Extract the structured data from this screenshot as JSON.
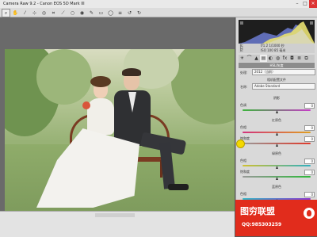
{
  "window": {
    "title": "Camera Raw 9.2 - Canon EOS 5D Mark III"
  },
  "window_buttons": {
    "minimize": "–",
    "maximize": "□",
    "close": "×"
  },
  "histogram": {
    "r_label": "R:",
    "g_label": "G:",
    "b_label": "B:",
    "line1": "f/1.2  1/1000 秒",
    "line2": "ISO 100  85 毫米"
  },
  "panel": {
    "title": "HSL/灰度",
    "process_label": "处理:",
    "process_value": "2012（当前）",
    "profile_header": "相机配置文件",
    "profile_label": "名称:",
    "profile_value": "Adobe Standard",
    "sections": {
      "shadows": "阴影",
      "reds": "红原色",
      "greens": "绿原色",
      "blues": "蓝原色"
    },
    "labels": {
      "tint": "色调",
      "hue": "色相",
      "saturation": "饱和度"
    },
    "values": {
      "shadow_tint": "0",
      "red_hue": "0",
      "red_saturation": "0",
      "green_hue": "0",
      "green_saturation": "0",
      "blue_hue": "0",
      "blue_saturation": "+20"
    }
  },
  "watermark": {
    "brand": "图穷联盟",
    "qq": "QQ:985303259"
  },
  "colors": {
    "watermark": "#e12c1c",
    "cursor_highlight": "#f4d800"
  }
}
